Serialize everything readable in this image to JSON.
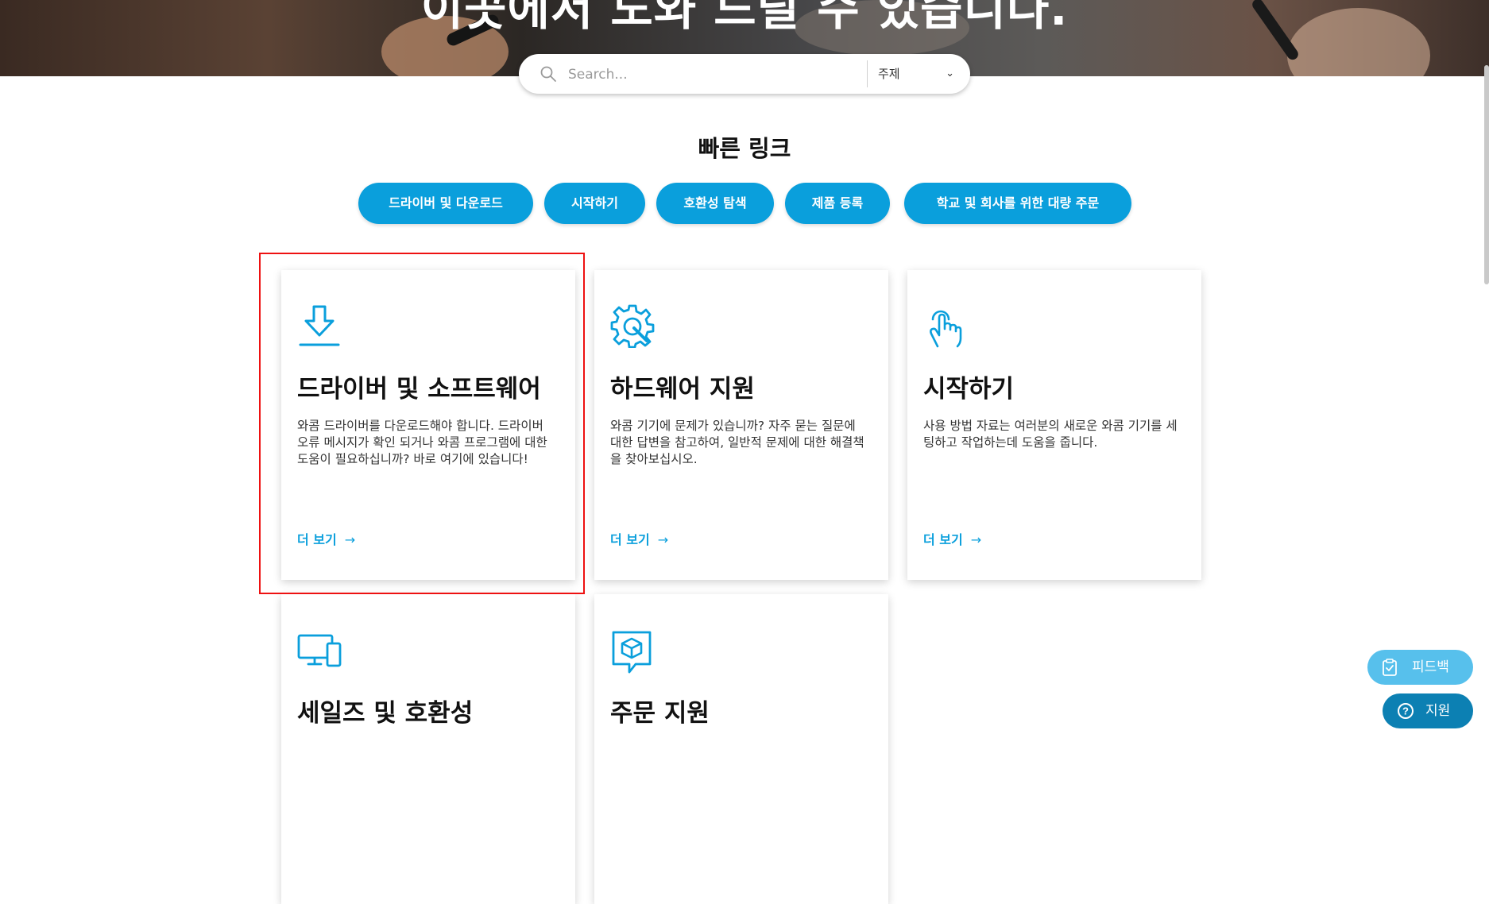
{
  "hero": {
    "title": "이곳에서 도와 드릴 수 있습니다."
  },
  "search": {
    "placeholder": "Search...",
    "topic_label": "주제"
  },
  "quick_links": {
    "title": "빠른 링크",
    "pills": [
      "드라이버 및 다운로드",
      "시작하기",
      "호환성 탐색",
      "제품 등록",
      "학교 및 회사를 위한 대량 주문"
    ]
  },
  "cards": [
    {
      "icon": "download-icon",
      "title": "드라이버 및 소프트웨어",
      "desc": "와콤 드라이버를 다운로드해야 합니다. 드라이버 오류 메시지가 확인 되거나 와콤 프로그램에 대한 도움이 필요하십니까? 바로 여기에 있습니다!",
      "more": "더 보기"
    },
    {
      "icon": "gear-wrench-icon",
      "title": "하드웨어 지원",
      "desc": "와콤 기기에 문제가 있습니까? 자주 묻는 질문에 대한 답변을 참고하여, 일반적 문제에 대한 해결책을 찾아보십시오.",
      "more": "더 보기"
    },
    {
      "icon": "touch-hand-icon",
      "title": "시작하기",
      "desc": "사용 방법 자료는 여러분의 새로운 와콤 기기를 세팅하고 작업하는데 도움을 줍니다.",
      "more": "더 보기"
    },
    {
      "icon": "devices-icon",
      "title": "세일즈 및 호환성"
    },
    {
      "icon": "package-chat-icon",
      "title": "주문 지원"
    }
  ],
  "floating": {
    "feedback": "피드백",
    "support": "지원"
  },
  "colors": {
    "accent": "#0a9fdc",
    "support_btn": "#0c80b3",
    "feedback_btn": "#57c0ec",
    "highlight": "#e11"
  }
}
